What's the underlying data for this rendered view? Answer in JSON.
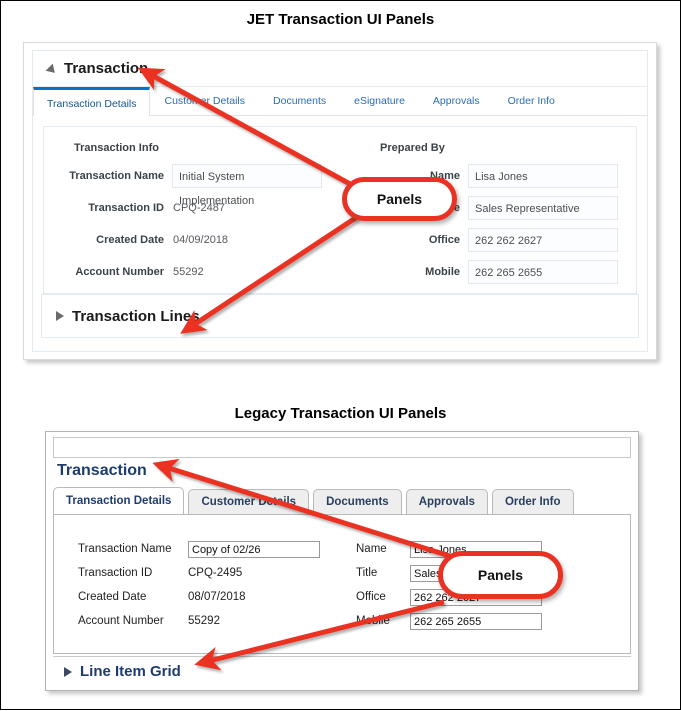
{
  "page": {
    "background": "#ffffff",
    "border_color": "#000000",
    "accent_blue": "#0572ce",
    "legacy_navy": "#1f3c6e",
    "annotation_red": "#ea3224"
  },
  "jet": {
    "section_title": "JET Transaction UI Panels",
    "panel_title": "Transaction",
    "collapse_icon": "triangle-down-icon",
    "tabs": [
      {
        "label": "Transaction Details",
        "active": true
      },
      {
        "label": "Customer Details",
        "active": false
      },
      {
        "label": "Documents",
        "active": false
      },
      {
        "label": "eSignature",
        "active": false
      },
      {
        "label": "Approvals",
        "active": false
      },
      {
        "label": "Order Info",
        "active": false
      }
    ],
    "left_group_heading": "Transaction Info",
    "right_group_heading": "Prepared By",
    "left_fields": [
      {
        "label": "Transaction Name",
        "value": "Initial System Implementation",
        "type": "input"
      },
      {
        "label": "Transaction ID",
        "value": "CPQ-2487",
        "type": "text"
      },
      {
        "label": "Created Date",
        "value": "04/09/2018",
        "type": "text"
      },
      {
        "label": "Account Number",
        "value": "55292",
        "type": "text"
      }
    ],
    "right_fields": [
      {
        "label": "Name",
        "value": "Lisa Jones",
        "type": "input"
      },
      {
        "label": "Title",
        "value": "Sales Representative",
        "type": "input"
      },
      {
        "label": "Office",
        "value": "262 262 2627",
        "type": "input"
      },
      {
        "label": "Mobile",
        "value": "262 265 2655",
        "type": "input"
      }
    ],
    "lines_panel_title": "Transaction Lines",
    "lines_expand_icon": "triangle-right-icon"
  },
  "legacy": {
    "section_title": "Legacy Transaction UI Panels",
    "panel_title": "Transaction",
    "tabs": [
      {
        "label": "Transaction Details",
        "active": true
      },
      {
        "label": "Customer Details",
        "active": false
      },
      {
        "label": "Documents",
        "active": false
      },
      {
        "label": "Approvals",
        "active": false
      },
      {
        "label": "Order Info",
        "active": false
      }
    ],
    "left_fields": [
      {
        "label": "Transaction Name",
        "value": "Copy of 02/26",
        "type": "input"
      },
      {
        "label": "Transaction ID",
        "value": "CPQ-2495",
        "type": "text"
      },
      {
        "label": "Created Date",
        "value": "08/07/2018",
        "type": "text"
      },
      {
        "label": "Account Number",
        "value": "55292",
        "type": "text"
      }
    ],
    "right_fields": [
      {
        "label": "Name",
        "value": "Lisa Jones",
        "type": "input"
      },
      {
        "label": "Title",
        "value": "Sales Rep",
        "type": "input"
      },
      {
        "label": "Office",
        "value": "262 262 2627",
        "type": "input"
      },
      {
        "label": "Mobile",
        "value": "262 265 2655",
        "type": "input"
      }
    ],
    "grid_panel_title": "Line Item Grid",
    "grid_expand_icon": "triangle-right-icon"
  },
  "annotations": {
    "jet_callout_label": "Panels",
    "legacy_callout_label": "Panels"
  }
}
